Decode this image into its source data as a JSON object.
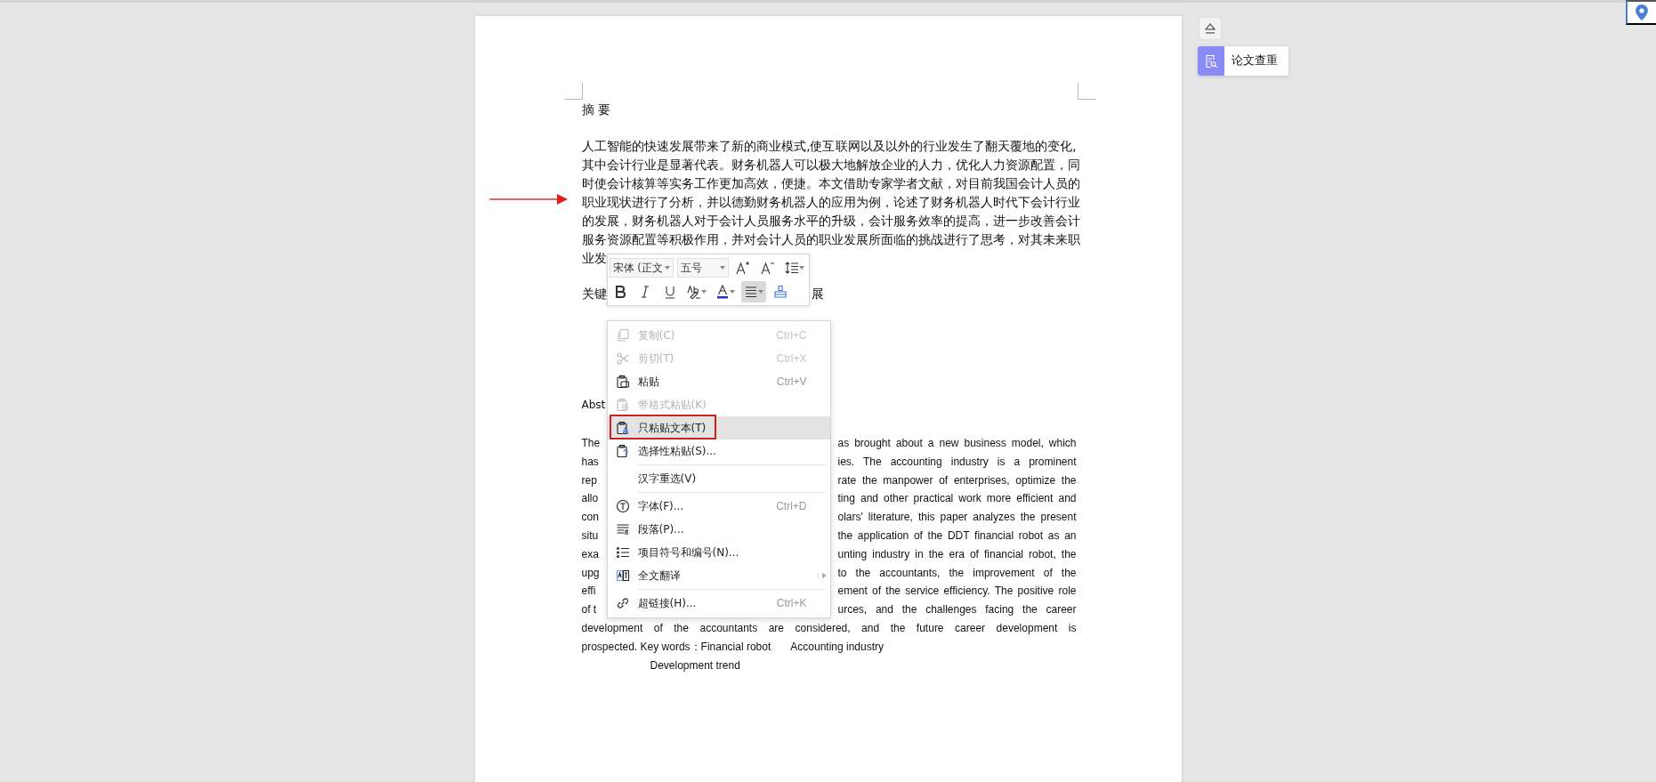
{
  "page": {
    "heading": "摘 要",
    "cn_lines": [
      "人工智能的快速发展带来了新的商业模式,使互联网以及以外的行业发生了翻天覆地的变化,",
      "其中会计行业是显著代表。财务机器人可以极大地解放企业的人力，优化人力资源配置，同",
      "时使会计核算等实务工作更加高效，便捷。本文借助专家学者文献，对目前我国会计人员的",
      "职业现状进行了分析，并以德勤财务机器人的应用为例，论述了财务机器人时代下会计行业",
      "的发展，财务机器人对于会计人员服务水平的升级，会计服务效率的提高，进一步改善会计",
      "服务资源配置等积极作用，并对会计人员的职业发展所面临的挑战进行了思考，对其未来职"
    ],
    "cn_last_fragment": "业发",
    "keywords_left": "关键",
    "keywords_right": "展",
    "abstract_heading": "Abst",
    "en_lines": [
      {
        "left": "The",
        "right": "as brought about a new business model, which"
      },
      {
        "left": "has",
        "right": "ies. The accounting industry is a prominent"
      },
      {
        "left": "rep",
        "right": "rate the manpower of enterprises, optimize the"
      },
      {
        "left": "allo",
        "right": "ting and other practical work more efficient and"
      },
      {
        "left": "con",
        "right": "olars' literature, this paper analyzes the present"
      },
      {
        "left": "situ",
        "right": "the application of the DDT financial robot as an"
      },
      {
        "left": "exa",
        "right": "unting industry in the era of financial robot, the"
      },
      {
        "left": "upg",
        "right": "to the accountants, the improvement of the"
      },
      {
        "left": "effi",
        "right": "ement of the service efficiency. The positive role"
      },
      {
        "left": "of t",
        "right": "urces, and the challenges facing the career"
      }
    ],
    "en_full_line": "development of the accountants are considered, and the future career development is",
    "en_keywords": "prospected. Key words：Financial robot",
    "en_keyword_2": "Accounting industry",
    "en_keyword_3": "Development trend"
  },
  "mini_toolbar": {
    "font": "宋体 (正文",
    "size": "五号",
    "align_active": true
  },
  "context_menu": {
    "items": [
      {
        "kind": "item",
        "label": "复制(C)",
        "shortcut": "Ctrl+C",
        "disabled": true,
        "selected": false,
        "framed": false,
        "submenu": false
      },
      {
        "kind": "item",
        "label": "剪切(T)",
        "shortcut": "Ctrl+X",
        "disabled": true,
        "selected": false,
        "framed": false,
        "submenu": false
      },
      {
        "kind": "item",
        "label": "粘贴",
        "shortcut": "Ctrl+V",
        "disabled": false,
        "selected": false,
        "framed": false,
        "submenu": false
      },
      {
        "kind": "item",
        "label": "带格式粘贴(K)",
        "disabled": true,
        "selected": false,
        "framed": false,
        "submenu": false
      },
      {
        "kind": "item",
        "label": "只粘贴文本(T)",
        "disabled": false,
        "selected": true,
        "framed": true,
        "submenu": false
      },
      {
        "kind": "item",
        "label": "选择性粘贴(S)...",
        "disabled": false,
        "selected": false,
        "framed": false,
        "submenu": false
      },
      {
        "kind": "separator"
      },
      {
        "kind": "item",
        "label": "汉字重选(V)",
        "disabled": false,
        "selected": false,
        "framed": false,
        "submenu": false
      },
      {
        "kind": "separator"
      },
      {
        "kind": "item",
        "label": "字体(F)...",
        "shortcut": "Ctrl+D",
        "disabled": false,
        "selected": false,
        "framed": false,
        "submenu": false
      },
      {
        "kind": "item",
        "label": "段落(P)...",
        "disabled": false,
        "selected": false,
        "framed": false,
        "submenu": false
      },
      {
        "kind": "item",
        "label": "项目符号和编号(N)...",
        "disabled": false,
        "selected": false,
        "framed": false,
        "submenu": false
      },
      {
        "kind": "item",
        "label": "全文翻译",
        "disabled": false,
        "selected": false,
        "framed": false,
        "submenu": true
      },
      {
        "kind": "separator"
      },
      {
        "kind": "item",
        "label": "超链接(H)...",
        "shortcut": "Ctrl+K",
        "disabled": false,
        "selected": false,
        "framed": false,
        "submenu": false
      }
    ]
  },
  "side_panel": {
    "check_button": "论文查重"
  }
}
